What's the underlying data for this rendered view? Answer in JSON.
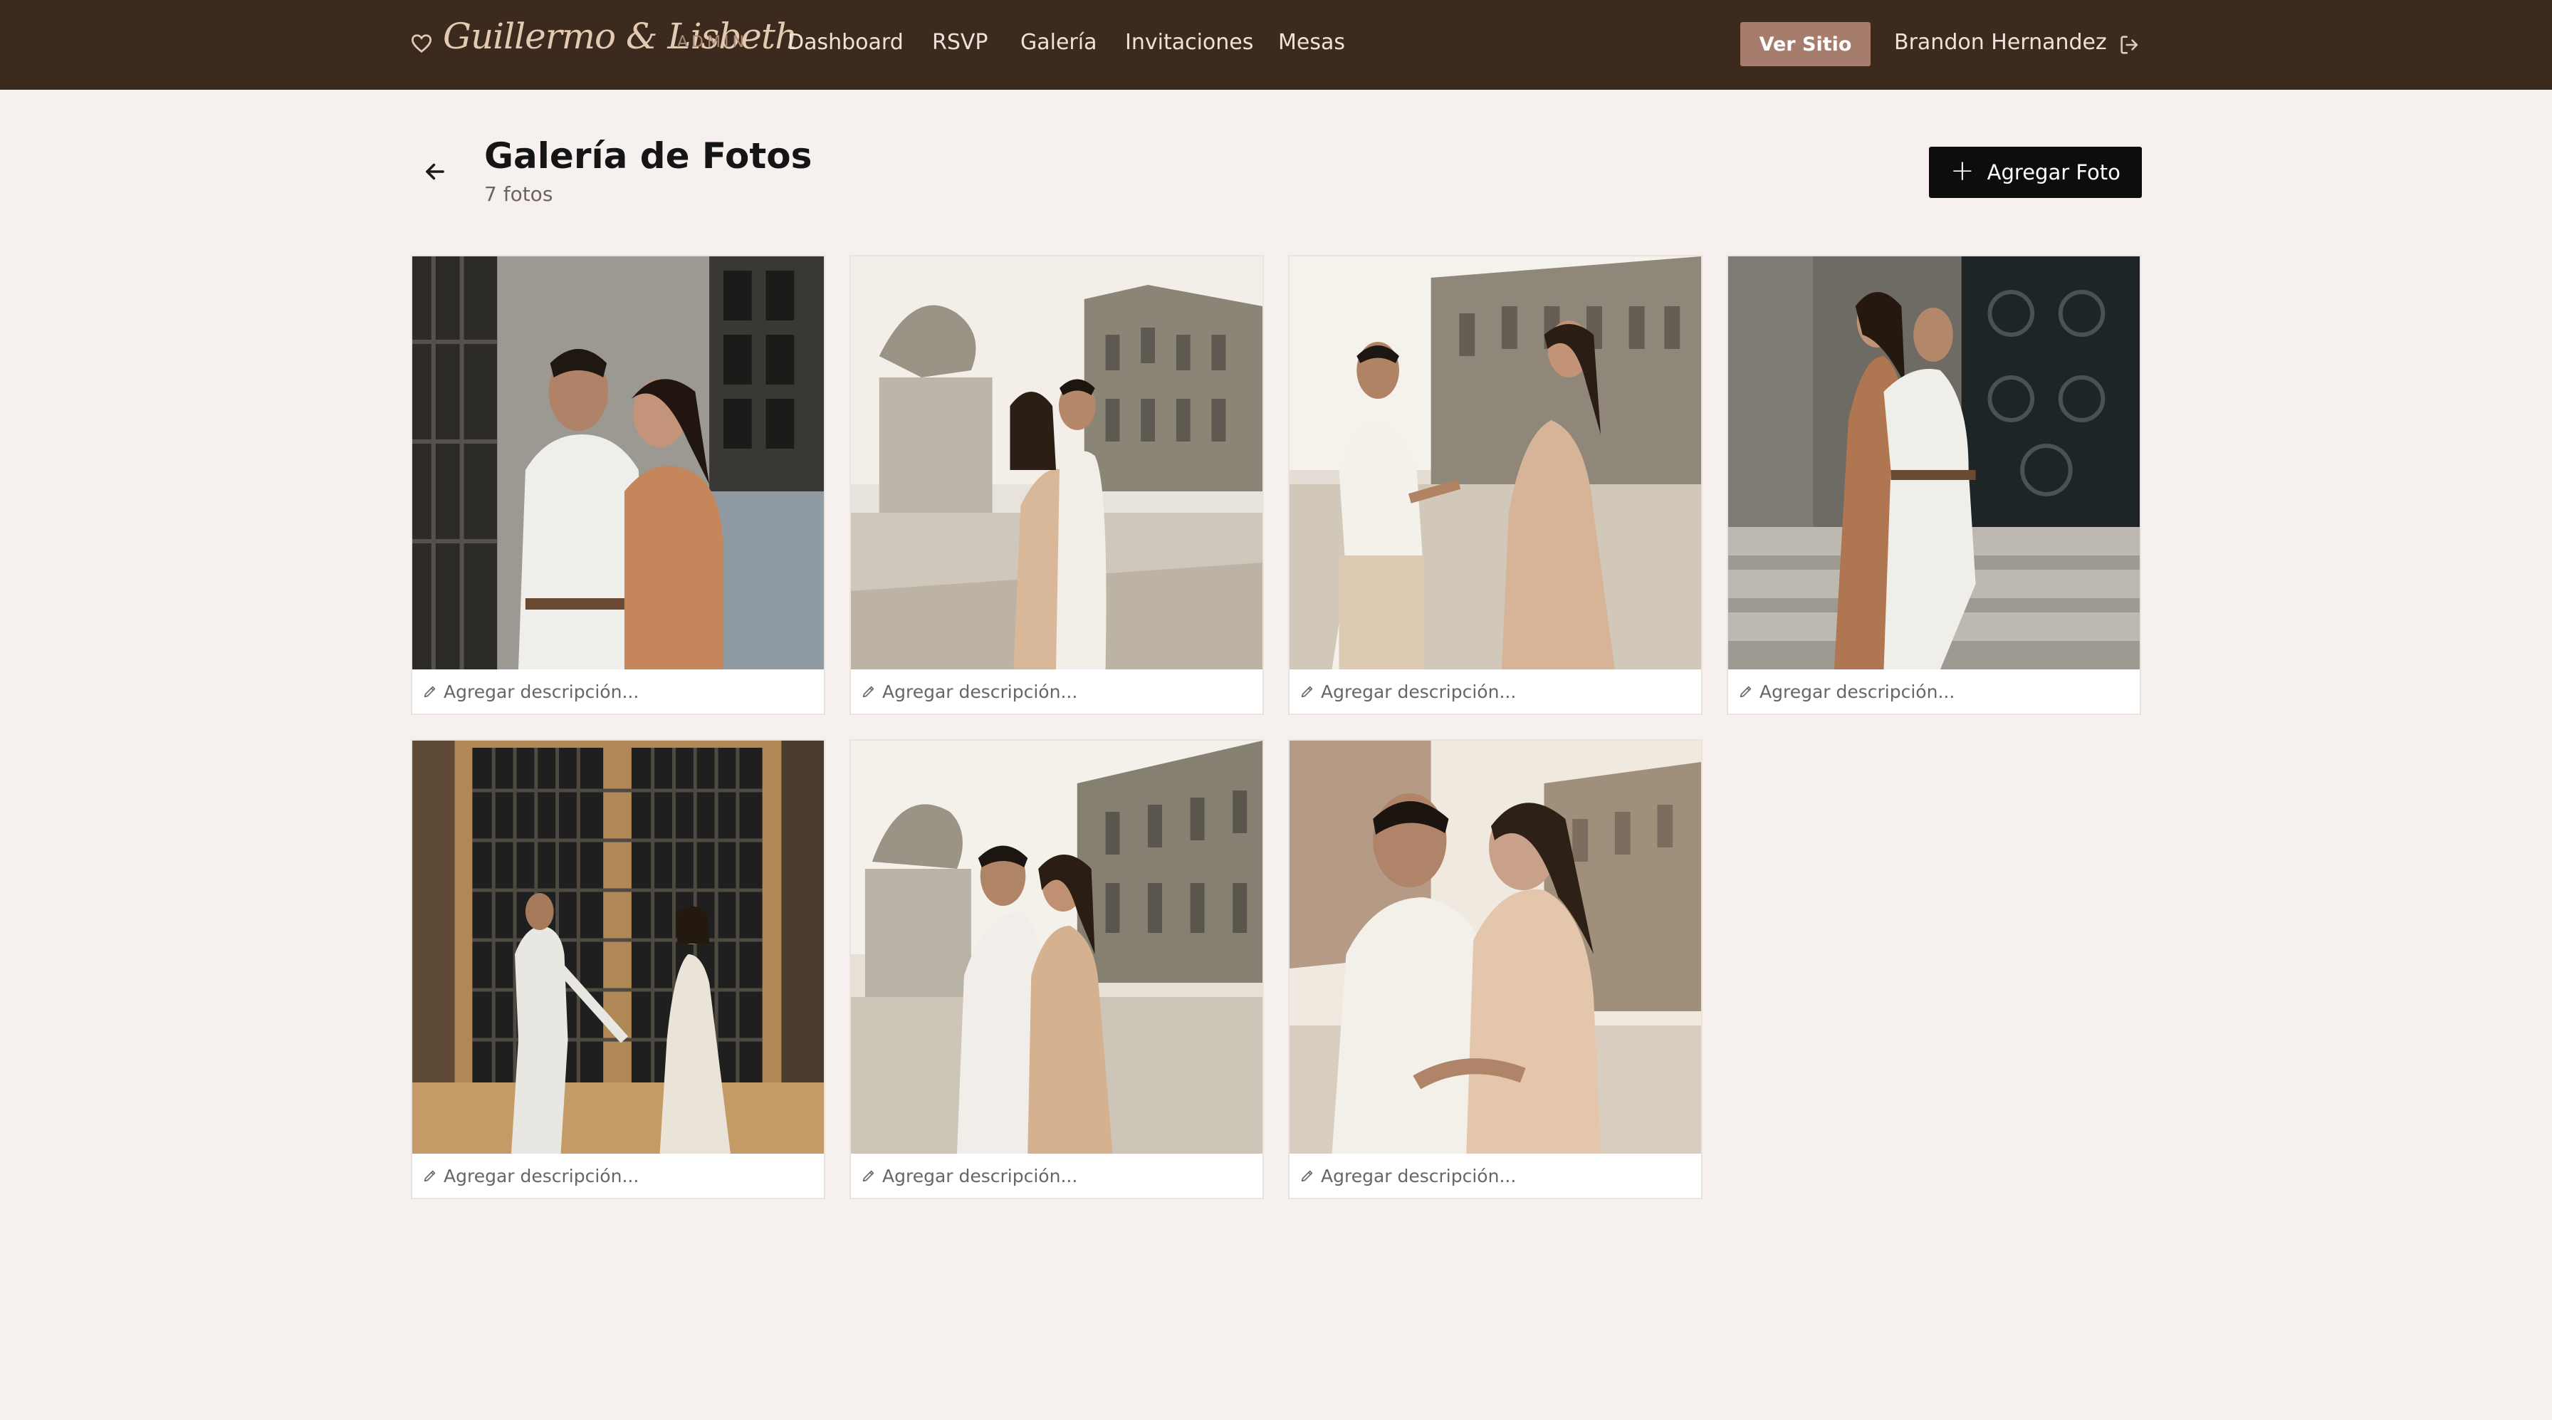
{
  "app": {
    "brand_name": "Guillermo & Lisbeth",
    "brand_badge": "ADMIN"
  },
  "nav": {
    "items": [
      {
        "label": "Dashboard",
        "icon": ""
      },
      {
        "label": "RSVP"
      },
      {
        "label": "Galería"
      },
      {
        "label": "Invitaciones"
      },
      {
        "label": "Mesas"
      }
    ],
    "site_button": "Ver Sitio",
    "user_name": "Brandon Hernandez"
  },
  "header": {
    "title": "Galería de Fotos",
    "subtitle": "7 fotos",
    "add_button": "Agregar Foto"
  },
  "photos": [
    {
      "caption": "Agregar descripción..."
    },
    {
      "caption": "Agregar descripción..."
    },
    {
      "caption": "Agregar descripción..."
    },
    {
      "caption": "Agregar descripción..."
    },
    {
      "caption": "Agregar descripción..."
    },
    {
      "caption": "Agregar descripción..."
    },
    {
      "caption": "Agregar descripción..."
    }
  ],
  "icons": {
    "brand": "heart-icon",
    "logout": "logout-icon",
    "back": "arrow-left-icon",
    "add": "plus-icon",
    "edit": "pencil-icon"
  },
  "colors": {
    "topbar": "#3d2a1f",
    "accent": "#a67c6d",
    "background": "#f6f1ee",
    "primary_button": "#0d0d0d"
  }
}
